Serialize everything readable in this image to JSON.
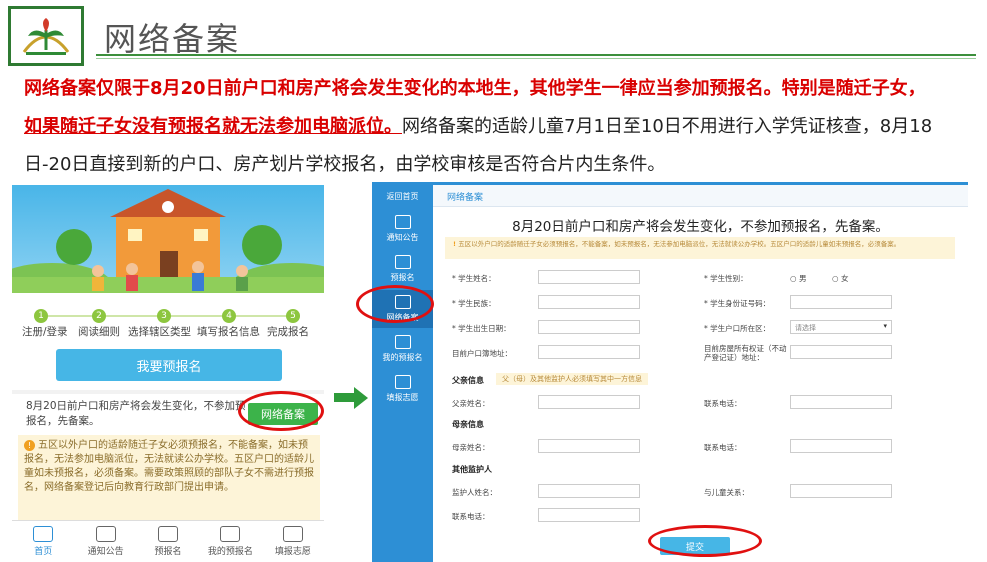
{
  "slide": {
    "title": "网络备案",
    "para_red1": "网络备案仅限于8月20日前户口和房产将会发生变化的本地生，其他学生一律应当参加预报名。特别是随迁子女，",
    "para_red2": "如果随迁子女没有预报名就无法参加电脑派位。",
    "para_rest": "网络备案的适龄儿童7月1日至10日不用进行入学凭证核查，8月18日-20日直接到新的户口、房产划片学校报名，由学校审核是否符合片内生条件。"
  },
  "phone": {
    "steps": [
      {
        "num": "1",
        "label": "注册/登录"
      },
      {
        "num": "2",
        "label": "阅读细则"
      },
      {
        "num": "3",
        "label": "选择辖区类型"
      },
      {
        "num": "4",
        "label": "填写报名信息"
      },
      {
        "num": "5",
        "label": "完成报名"
      }
    ],
    "pre_button": "我要预报名",
    "net_text": "8月20日前户口和房产将会发生变化，不参加预报名，先备案。",
    "net_button": "网络备案",
    "notice": "五区以外户口的适龄随迁子女必须预报名，不能备案，如未预报名，无法参加电脑派位，无法就读公办学校。五区户口的适龄儿童如未预报名，必须备案。需要政策照顾的部队子女不需进行预报名，网络备案登记后向教育行政部门提出申请。",
    "tabs": [
      "首页",
      "通知公告",
      "预报名",
      "我的预报名",
      "填报志愿"
    ]
  },
  "web": {
    "side_items": [
      "返回首页",
      "通知公告",
      "预报名",
      "网络备案",
      "我的预报名",
      "填报志愿"
    ],
    "crumb": "网络备案",
    "title": "8月20日前户口和房产将会发生变化，不参加预报名，先备案。",
    "notice": "五区以外户口的适龄随迁子女必须预报名，不能备案，如未预报名，无法参加电脑派位，无法就读公办学校。五区户口的适龄儿童如未预报名，必须备案。",
    "labels": {
      "name": "* 学生姓名：",
      "gender": "* 学生性别：",
      "male": "男",
      "female": "女",
      "nation": "* 学生民族：",
      "idcard": "* 学生身份证号码：",
      "birth": "* 学生出生日期：",
      "hukou_area": "* 学生户口所在区：",
      "select_ph": "请选择",
      "hukou_addr": "目前户口簿地址：",
      "house_addr": "目前房屋所有权证（不动产登记证）地址：",
      "father_sec": "父亲信息",
      "father_note": "父（母）及其他监护人必须填写其中一方信息",
      "father_name": "父亲姓名：",
      "father_phone": "联系电话：",
      "mother_sec": "母亲信息",
      "mother_name": "母亲姓名：",
      "mother_phone": "联系电话：",
      "guard_sec": "其他监护人",
      "guard_name": "监护人姓名：",
      "guard_rel": "与儿童关系：",
      "guard_phone": "联系电话："
    },
    "submit": "提交"
  }
}
